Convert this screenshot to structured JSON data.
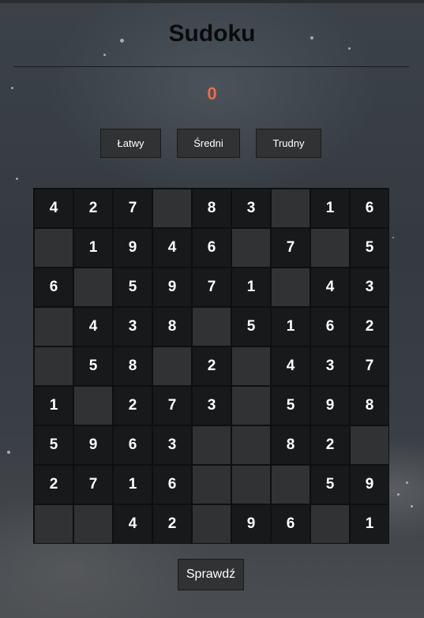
{
  "page": {
    "title": "Sudoku",
    "score": "0"
  },
  "difficulty": {
    "easy_label": "Łatwy",
    "medium_label": "Średni",
    "hard_label": "Trudny"
  },
  "board": {
    "rows": [
      [
        "4",
        "2",
        "7",
        "",
        "8",
        "3",
        "",
        "1",
        "6"
      ],
      [
        "",
        "1",
        "9",
        "4",
        "6",
        "",
        "7",
        "",
        "5"
      ],
      [
        "6",
        "",
        "5",
        "9",
        "7",
        "1",
        "",
        "4",
        "3"
      ],
      [
        "",
        "4",
        "3",
        "8",
        "",
        "5",
        "1",
        "6",
        "2"
      ],
      [
        "",
        "5",
        "8",
        "",
        "2",
        "",
        "4",
        "3",
        "7"
      ],
      [
        "1",
        "",
        "2",
        "7",
        "3",
        "",
        "5",
        "9",
        "8"
      ],
      [
        "5",
        "9",
        "6",
        "3",
        "",
        "",
        "8",
        "2",
        ""
      ],
      [
        "2",
        "7",
        "1",
        "6",
        "",
        "",
        "",
        "5",
        "9"
      ],
      [
        "",
        "",
        "4",
        "2",
        "",
        "9",
        "6",
        "",
        "1"
      ]
    ]
  },
  "actions": {
    "check_label": "Sprawdź"
  },
  "colors": {
    "score": "#f06a4a",
    "filled_cell": "#18191b",
    "empty_cell": "#313234"
  }
}
